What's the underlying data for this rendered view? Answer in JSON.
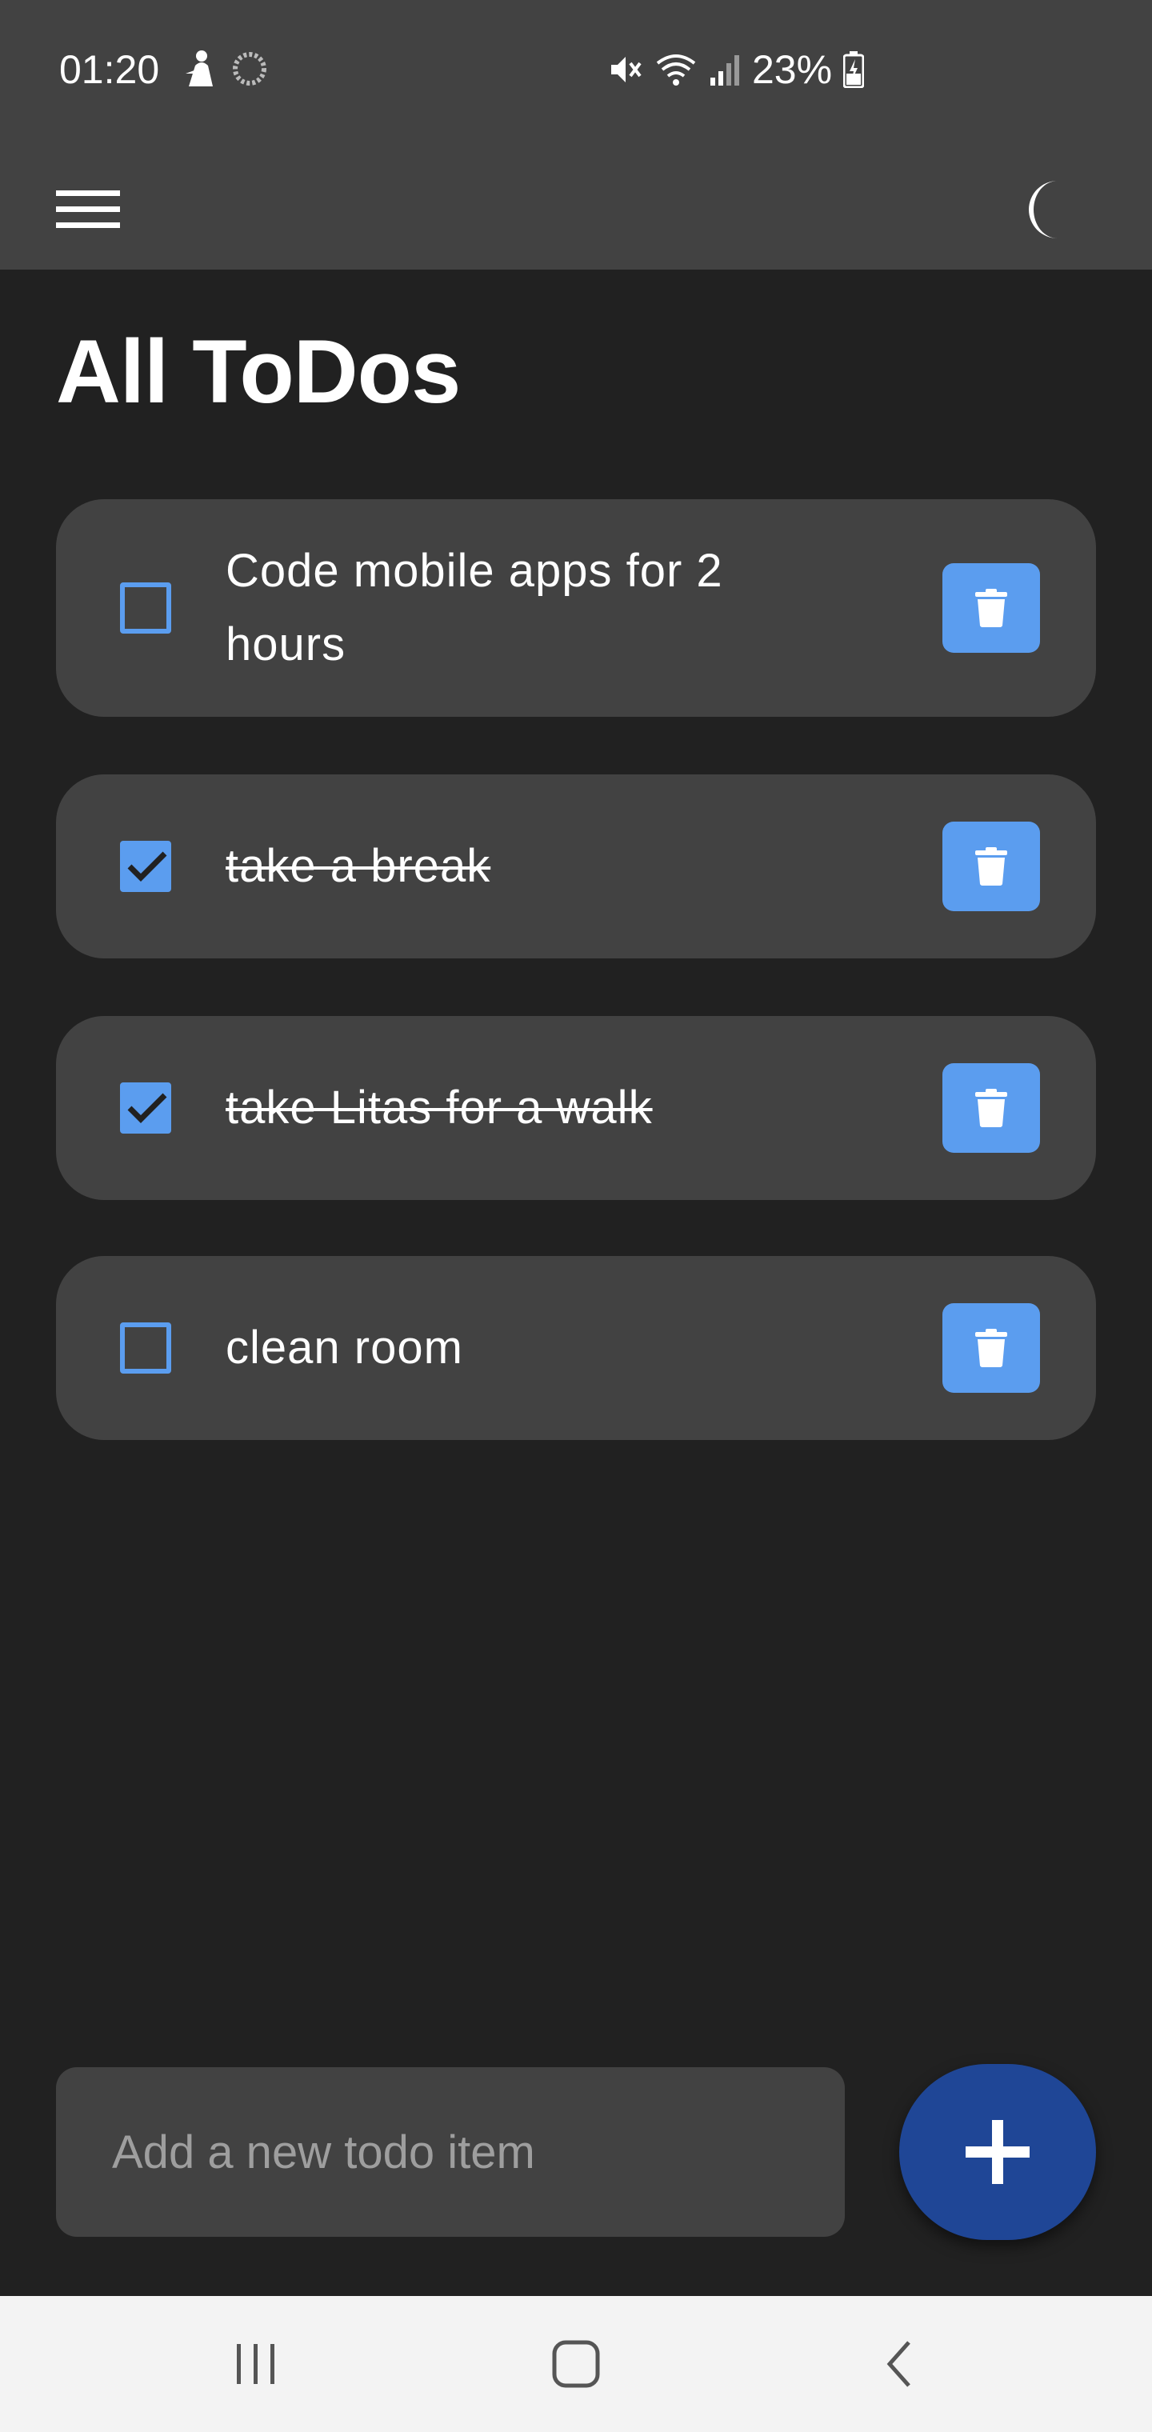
{
  "status_bar": {
    "time": "01:20",
    "battery": "23%",
    "icons": [
      "person-icon",
      "loading-icon",
      "mute-icon",
      "wifi-icon",
      "signal-icon",
      "battery-charging-icon"
    ]
  },
  "app_bar": {
    "menu_icon": "hamburger-menu-icon",
    "theme_icon": "moon-icon"
  },
  "page": {
    "title": "All ToDos"
  },
  "todos": [
    {
      "text": "Code mobile apps for 2 hours",
      "done": false
    },
    {
      "text": "take a break",
      "done": true
    },
    {
      "text": "take Litas for a walk",
      "done": true
    },
    {
      "text": "clean room",
      "done": false
    }
  ],
  "new_todo": {
    "placeholder": "Add a new todo item",
    "value": ""
  },
  "fab": {
    "icon": "plus-icon"
  },
  "nav_bar": {
    "icons": [
      "recents-icon",
      "home-icon",
      "back-icon"
    ]
  },
  "colors": {
    "background": "#212121",
    "surface": "#424242",
    "accent": "#5b9def",
    "fab": "#1f4696"
  }
}
